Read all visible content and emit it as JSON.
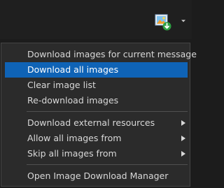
{
  "toolbar": {
    "download_button_icon": "image-download-icon",
    "dropdown_icon": "chevron-down-icon"
  },
  "menu": {
    "items": [
      {
        "label": "Download images for current message",
        "highlighted": false,
        "submenu": false
      },
      {
        "label": "Download all images",
        "highlighted": true,
        "submenu": false
      },
      {
        "label": "Clear image list",
        "highlighted": false,
        "submenu": false
      },
      {
        "label": "Re-download images",
        "highlighted": false,
        "submenu": false
      },
      {
        "label": "Download external resources",
        "highlighted": false,
        "submenu": true
      },
      {
        "label": "Allow all images from",
        "highlighted": false,
        "submenu": true
      },
      {
        "label": "Skip all images from",
        "highlighted": false,
        "submenu": true
      },
      {
        "label": "Open Image Download Manager",
        "highlighted": false,
        "submenu": false
      }
    ]
  },
  "colors": {
    "menu_background": "#2b2b2b",
    "highlight": "#0f63b6",
    "text": "#d8d8d8",
    "badge_green": "#2ea043"
  }
}
